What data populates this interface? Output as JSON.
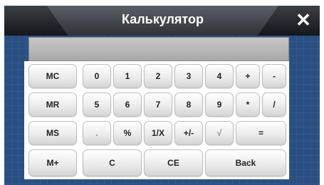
{
  "window": {
    "title": "Калькулятор",
    "close_glyph": "✕"
  },
  "display": {
    "value": ""
  },
  "keys": {
    "mc": "MC",
    "mr": "MR",
    "ms": "MS",
    "mplus": "M+",
    "d0": "0",
    "d1": "1",
    "d2": "2",
    "d3": "3",
    "d4": "4",
    "d5": "5",
    "d6": "6",
    "d7": "7",
    "d8": "8",
    "d9": "9",
    "plus": "+",
    "minus": "-",
    "multiply": "*",
    "divide": "/",
    "dot": ".",
    "percent": "%",
    "reciprocal": "1/X",
    "negate": "+/-",
    "sqrt": "√",
    "equals": "=",
    "clear": "C",
    "clear_entry": "CE",
    "back": "Back"
  }
}
